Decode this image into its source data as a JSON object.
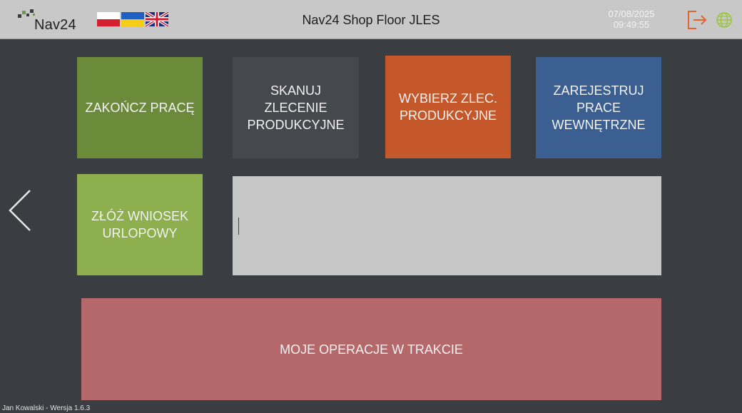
{
  "header": {
    "brand": "Nav24",
    "title": "Nav24 Shop Floor JLES",
    "date": "07/08/2025",
    "time": "09:49:55",
    "languages": [
      "pl-flag-icon",
      "ua-flag-icon",
      "gb-flag-icon"
    ]
  },
  "tiles": {
    "finish_work": [
      "ZAKOŃCZ PRACĘ"
    ],
    "scan_order": [
      "SKANUJ ZLECENIE",
      "PRODUKCYJNE"
    ],
    "choose_order": [
      "WYBIERZ ZLEC.",
      "PRODUKCYJNE"
    ],
    "register_internal": [
      "ZAREJESTRUJ",
      "PRACE",
      "WEWNĘTRZNE"
    ],
    "leave_request": [
      "ZŁÓŻ WNIOSEK",
      "URLOPOWY"
    ],
    "my_operations": [
      "MOJE OPERACJE W TRAKCIE"
    ]
  },
  "scan_input": {
    "value": ""
  },
  "footer": {
    "user": "Jan Kowalski",
    "version": "Wersja 1.6.3"
  },
  "colors": {
    "background": "#3a3d42",
    "header": "#c8c8c8",
    "finish_work": "#6b8b3b",
    "scan_order": "#45484d",
    "choose_order": "#c5582b",
    "register_internal": "#3c5f91",
    "leave_request": "#8daf4d",
    "my_operations": "#b4686a",
    "logout_accent": "#e0652f",
    "globe_accent": "#9cc43c"
  }
}
